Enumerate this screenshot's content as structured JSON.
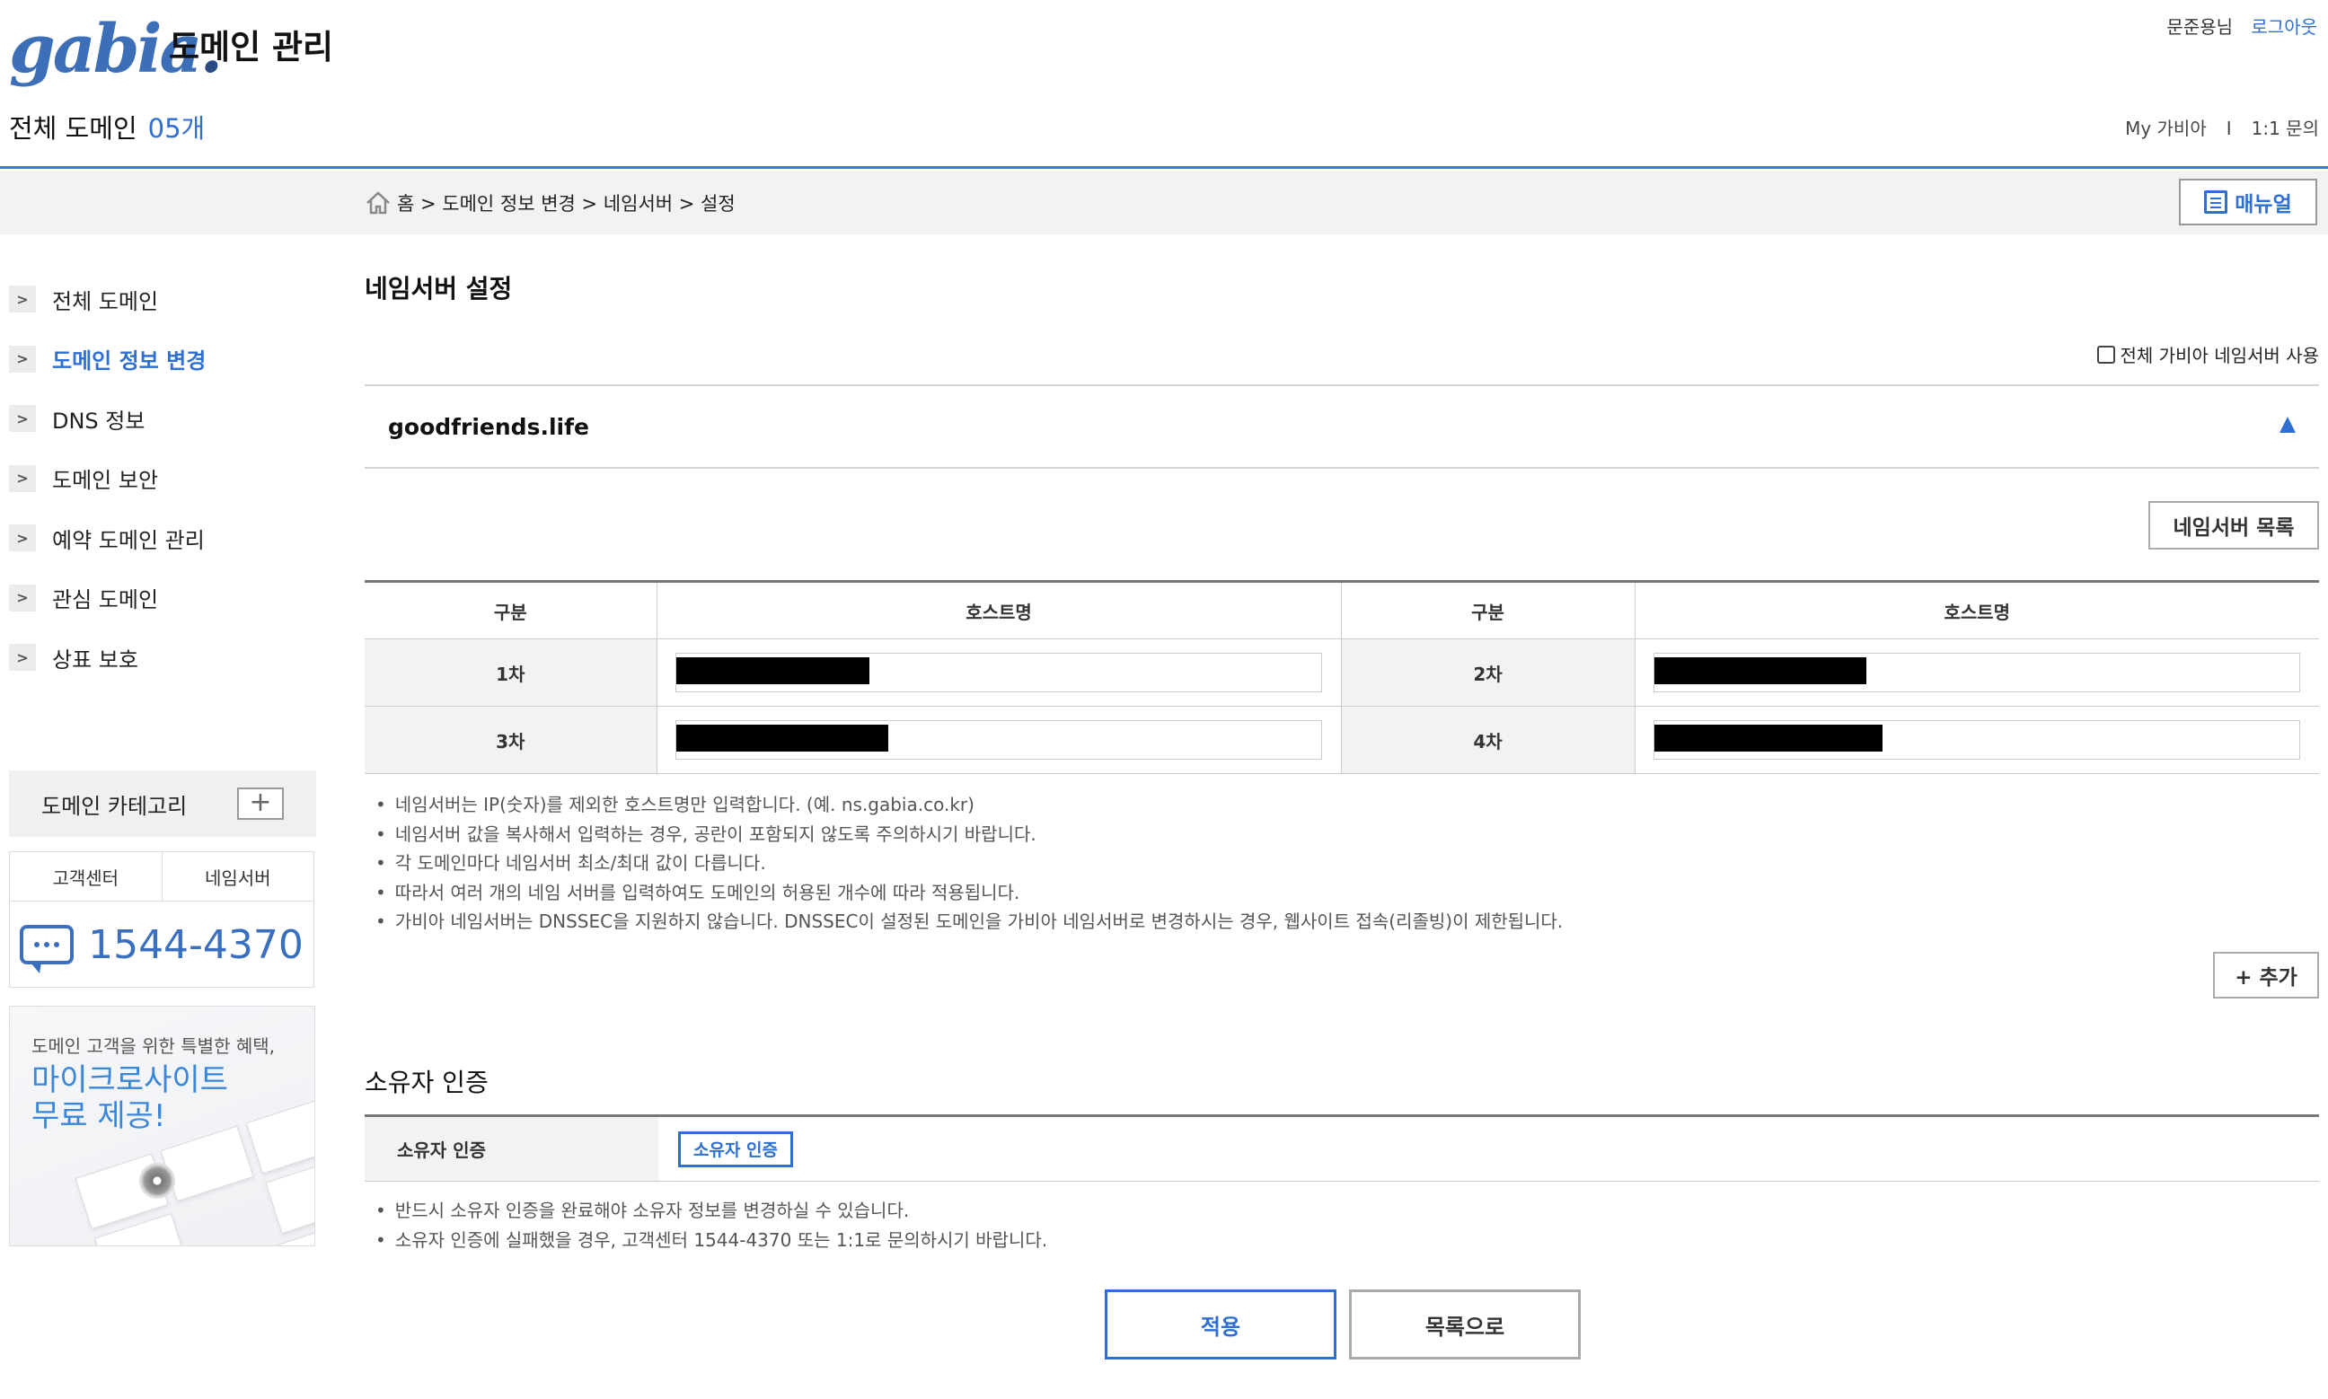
{
  "header": {
    "logo_text": "gabia",
    "logo_dot": ".",
    "app_title": "도메인 관리",
    "user_name": "문준용님",
    "logout": "로그아웃",
    "total_label": "전체 도메인",
    "total_count": "05개",
    "my_gabia": "My 가비아",
    "separator": "I",
    "inquiry": "1:1 문의"
  },
  "breadcrumb": {
    "text": "홈 > 도메인 정보 변경 > 네임서버 > 설정",
    "manual_label": "매뉴얼"
  },
  "sidebar": {
    "items": [
      {
        "label": "전체 도메인",
        "active": false
      },
      {
        "label": "도메인 정보 변경",
        "active": true
      },
      {
        "label": "DNS 정보",
        "active": false
      },
      {
        "label": "도메인 보안",
        "active": false
      },
      {
        "label": "예약 도메인 관리",
        "active": false
      },
      {
        "label": "관심 도메인",
        "active": false
      },
      {
        "label": "상표 보호",
        "active": false
      }
    ],
    "category_label": "도메인 카테고리",
    "category_add": "+",
    "cs_tabs": [
      "고객센터",
      "네임서버"
    ],
    "phone": "1544-4370",
    "banner_sub": "도메인 고객을 위한 특별한 혜택,",
    "banner_line1": "마이크로사이트",
    "banner_line2": "무료 제공!"
  },
  "main": {
    "title": "네임서버 설정",
    "all_ns_label": "전체 가비아 네임서버 사용",
    "domain": "goodfriends.life",
    "ns_list_button": "네임서버 목록",
    "table_headers": [
      "구분",
      "호스트명",
      "구분",
      "호스트명"
    ],
    "rows": [
      {
        "l1": "1차",
        "l2": "2차"
      },
      {
        "l1": "3차",
        "l2": "4차"
      }
    ],
    "notes": [
      "네임서버는 IP(숫자)를 제외한 호스트명만 입력합니다. (예. ns.gabia.co.kr)",
      "네임서버 값을 복사해서 입력하는 경우, 공란이 포함되지 않도록 주의하시기 바랍니다.",
      "각 도메인마다 네임서버 최소/최대 값이 다릅니다.",
      "따라서 여러 개의 네임 서버를 입력하여도 도메인의 허용된 개수에 따라 적용됩니다.",
      "가비아 네임서버는 DNSSEC을 지원하지 않습니다. DNSSEC이 설정된 도메인을 가비아 네임서버로 변경하시는 경우, 웹사이트 접속(리졸빙)이 제한됩니다."
    ],
    "add_button": "+ 추가",
    "owner_title": "소유자 인증",
    "owner_label": "소유자 인증",
    "owner_button": "소유자 인증",
    "owner_notes": [
      "반드시 소유자 인증을 완료해야 소유자 정보를 변경하실 수 있습니다.",
      "소유자 인증에 실패했을 경우, 고객센터 1544-4370 또는 1:1로 문의하시기 바랍니다."
    ],
    "apply_button": "적용",
    "list_button": "목록으로"
  },
  "colors": {
    "accent": "#2f6fd3",
    "redaction": "#000000"
  }
}
